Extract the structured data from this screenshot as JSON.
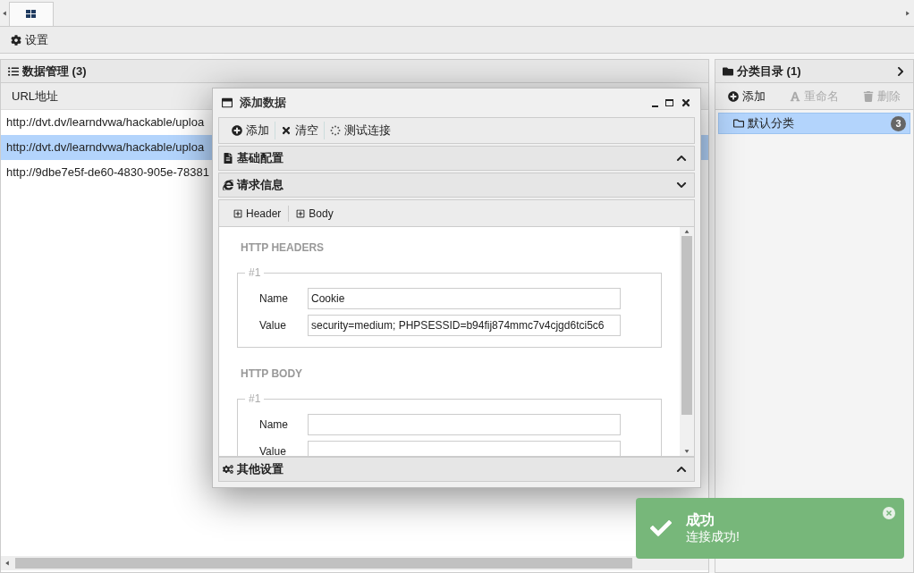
{
  "toolbar": {
    "settings": "设置"
  },
  "data_panel": {
    "title": "数据管理 (3)",
    "columns": [
      "URL地址"
    ],
    "rows": [
      {
        "url": "http://dvt.dv/learndvwa/hackable/uploa",
        "selected": false
      },
      {
        "url": "http://dvt.dv/learndvwa/hackable/uploa",
        "selected": true
      },
      {
        "url": "http://9dbe7e5f-de60-4830-905e-78381",
        "selected": false
      }
    ]
  },
  "category_panel": {
    "title": "分类目录 (1)",
    "actions": [
      {
        "label": "添加",
        "disabled": false,
        "kind": "add"
      },
      {
        "label": "重命名",
        "disabled": true,
        "kind": "rename"
      },
      {
        "label": "删除",
        "disabled": true,
        "kind": "delete"
      }
    ],
    "items": [
      {
        "label": "默认分类",
        "count": "3",
        "selected": true
      }
    ]
  },
  "dialog": {
    "title": "添加数据",
    "actions": [
      {
        "label": "添加",
        "kind": "add"
      },
      {
        "label": "清空",
        "kind": "clear"
      },
      {
        "label": "测试连接",
        "kind": "test"
      }
    ],
    "sections": [
      {
        "label": "基础配置",
        "kind": "doc",
        "expanded": false
      },
      {
        "label": "请求信息",
        "kind": "browser",
        "expanded": true
      }
    ],
    "tabs": [
      {
        "label": "Header"
      },
      {
        "label": "Body"
      }
    ],
    "groups": [
      {
        "heading": "HTTP HEADERS",
        "legend": "#1",
        "fields": [
          {
            "label": "Name",
            "value": "Cookie"
          },
          {
            "label": "Value",
            "value": "security=medium; PHPSESSID=b94fij874mmc7v4cjgd6tci5c6"
          }
        ]
      },
      {
        "heading": "HTTP BODY",
        "legend": "#1",
        "fields": [
          {
            "label": "Name"
          },
          {
            "label": "Value"
          }
        ]
      }
    ],
    "footer_section": {
      "label": "其他设置",
      "expanded": false
    }
  },
  "toast": {
    "title": "成功",
    "message": "连接成功!"
  }
}
